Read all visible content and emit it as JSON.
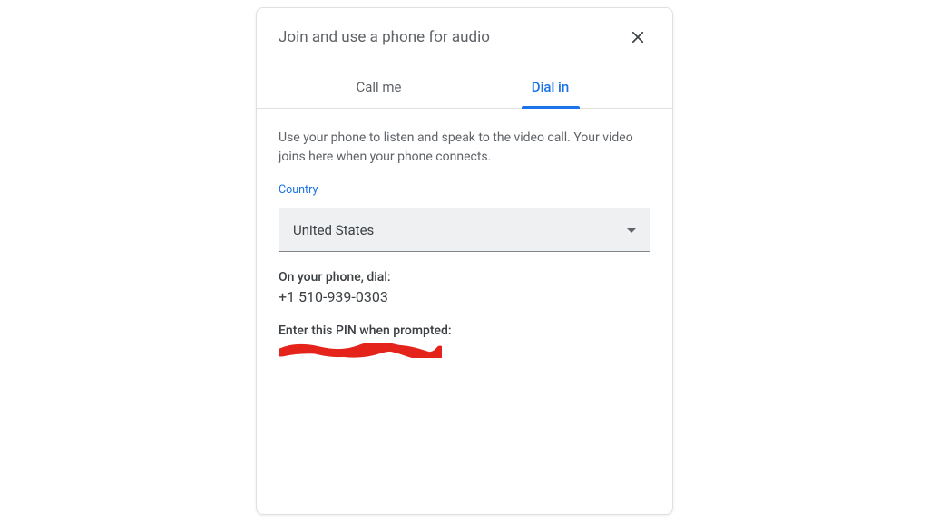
{
  "dialog": {
    "title": "Join and use a phone for audio",
    "tabs": {
      "call_me": "Call me",
      "dial_in": "Dial in"
    },
    "description": "Use your phone to listen and speak to the video call. Your video joins here when your phone connects.",
    "country_label": "Country",
    "country_selected": "United States",
    "dial_label": "On your phone, dial:",
    "phone_number": "+1 510-939-0303",
    "pin_label": "Enter this PIN when prompted:"
  }
}
